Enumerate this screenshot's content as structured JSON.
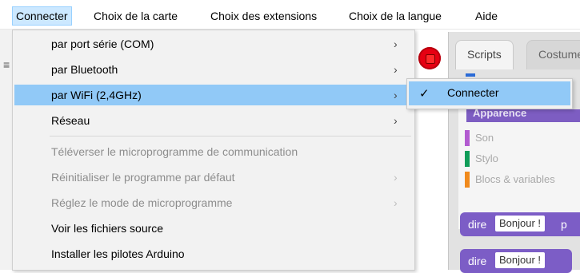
{
  "menubar": {
    "items": [
      "Connecter",
      "Choix de la carte",
      "Choix des extensions",
      "Choix de la langue",
      "Aide"
    ]
  },
  "connect_menu": {
    "items": [
      {
        "label": "par port série (COM)",
        "submenu": true,
        "enabled": true
      },
      {
        "label": "par Bluetooth",
        "submenu": true,
        "enabled": true
      },
      {
        "label": "par WiFi (2,4GHz)",
        "submenu": true,
        "enabled": true,
        "highlighted": true
      },
      {
        "label": "Réseau",
        "submenu": true,
        "enabled": true
      },
      {
        "label": "Téléverser le microprogramme de communication",
        "submenu": false,
        "enabled": false
      },
      {
        "label": "Réinitialiser le programme par défaut",
        "submenu": true,
        "enabled": false
      },
      {
        "label": "Réglez le mode de microprogramme",
        "submenu": true,
        "enabled": false
      },
      {
        "label": "Voir les fichiers source",
        "submenu": false,
        "enabled": true
      },
      {
        "label": "Installer les pilotes Arduino",
        "submenu": false,
        "enabled": true
      }
    ],
    "arrow_glyph": "›"
  },
  "wifi_submenu": {
    "check": "✓",
    "label": "Connecter"
  },
  "background": {
    "tabs": [
      "Scripts",
      "Costumes"
    ],
    "category_header": "Apparence",
    "categories": [
      {
        "label": "Son",
        "color": "#b25ad0"
      },
      {
        "label": "Stylo",
        "color": "#0f9d58"
      },
      {
        "label": "Blocs & variables",
        "color": "#f08a1c"
      }
    ],
    "blocks": [
      {
        "keyword": "dire",
        "text": "Bonjour !",
        "tail": "p"
      },
      {
        "keyword": "dire",
        "text": "Bonjour !",
        "tail": ""
      }
    ]
  },
  "colors": {
    "highlight": "#91c9f7",
    "menubar_active": "#cce8ff",
    "looks_purple": "#7c5dc6",
    "stop_red": "#e60012"
  }
}
